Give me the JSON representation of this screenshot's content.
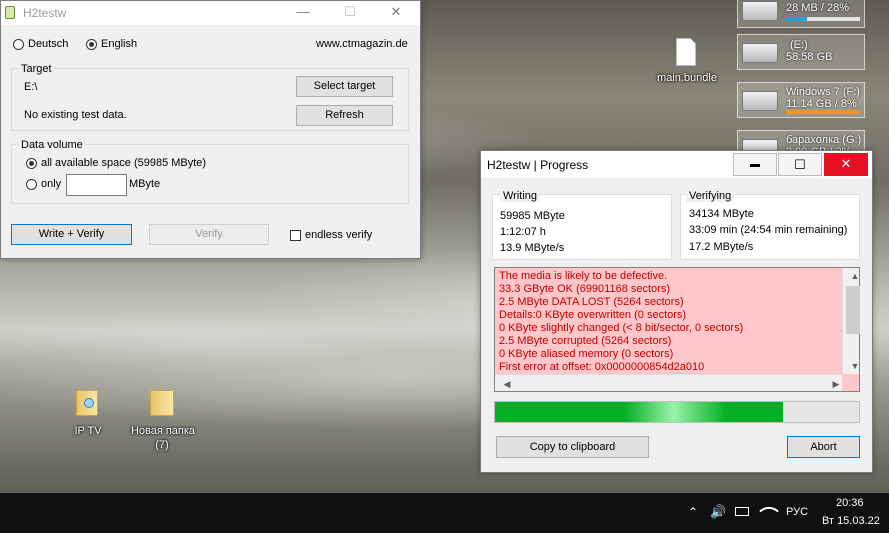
{
  "desktop": {
    "icons": [
      {
        "label": "main.bundle"
      },
      {
        "label": "IP TV"
      },
      {
        "label": "Новая папка"
      },
      {
        "label": "(7)"
      }
    ],
    "drives": [
      {
        "name": "",
        "info": "28 MB / 28%"
      },
      {
        "name": "(E:)",
        "info": "58.58 GB"
      },
      {
        "name": "Windows 7 (F:)",
        "info": "11.14 GB / 8%"
      },
      {
        "name": "барахолка (G:)",
        "info": "3,90 GB / 3%"
      }
    ]
  },
  "main_window": {
    "title": "H2testw",
    "lang_de": "Deutsch",
    "lang_en": "English",
    "website": "www.ctmagazin.de",
    "target_group": "Target",
    "target_path": "E:\\",
    "select_target": "Select target",
    "no_data": "No existing test data.",
    "refresh": "Refresh",
    "volume_group": "Data volume",
    "all_space": "all available space (59985 MByte)",
    "only": "only",
    "only_value": "",
    "mbyte": "MByte",
    "write_verify": "Write + Verify",
    "verify": "Verify",
    "endless": "endless verify",
    "minimize": "—",
    "maximize": "☐",
    "close": "✕"
  },
  "progress_window": {
    "title": "H2testw | Progress",
    "minimize": "▬",
    "maximize": "☐",
    "close": "✕",
    "writing": {
      "label": "Writing",
      "amount": "59985 MByte",
      "time": "1:12:07 h",
      "speed": "13.9 MByte/s"
    },
    "verifying": {
      "label": "Verifying",
      "amount": "34134 MByte",
      "time": "33:09 min (24:54 min remaining)",
      "speed": "17.2 MByte/s"
    },
    "log": [
      "The media is likely to be defective.",
      "33.3 GByte OK (69901168 sectors)",
      "2.5 MByte DATA LOST (5264 sectors)",
      "Details:0 KByte overwritten (0 sectors)",
      "0 KByte slightly changed (< 8 bit/sector, 0 sectors)",
      "2.5 MByte corrupted (5264 sectors)",
      "0 KByte aliased memory (0 sectors)",
      "First error at offset: 0x0000000854d2a010"
    ],
    "progress_fraction": 0.79,
    "copy": "Copy to clipboard",
    "abort": "Abort"
  },
  "taskbar": {
    "lang": "РУС",
    "time": "20:36",
    "date": "Вт 15.03.22"
  },
  "colors": {
    "progress_green": "#06b025",
    "log_bg": "#ffc7c9",
    "log_text": "#c00000",
    "close_red": "#e81123",
    "drive_bar_blue": "#26a0da",
    "drive_bar_orange": "#f7941d"
  }
}
